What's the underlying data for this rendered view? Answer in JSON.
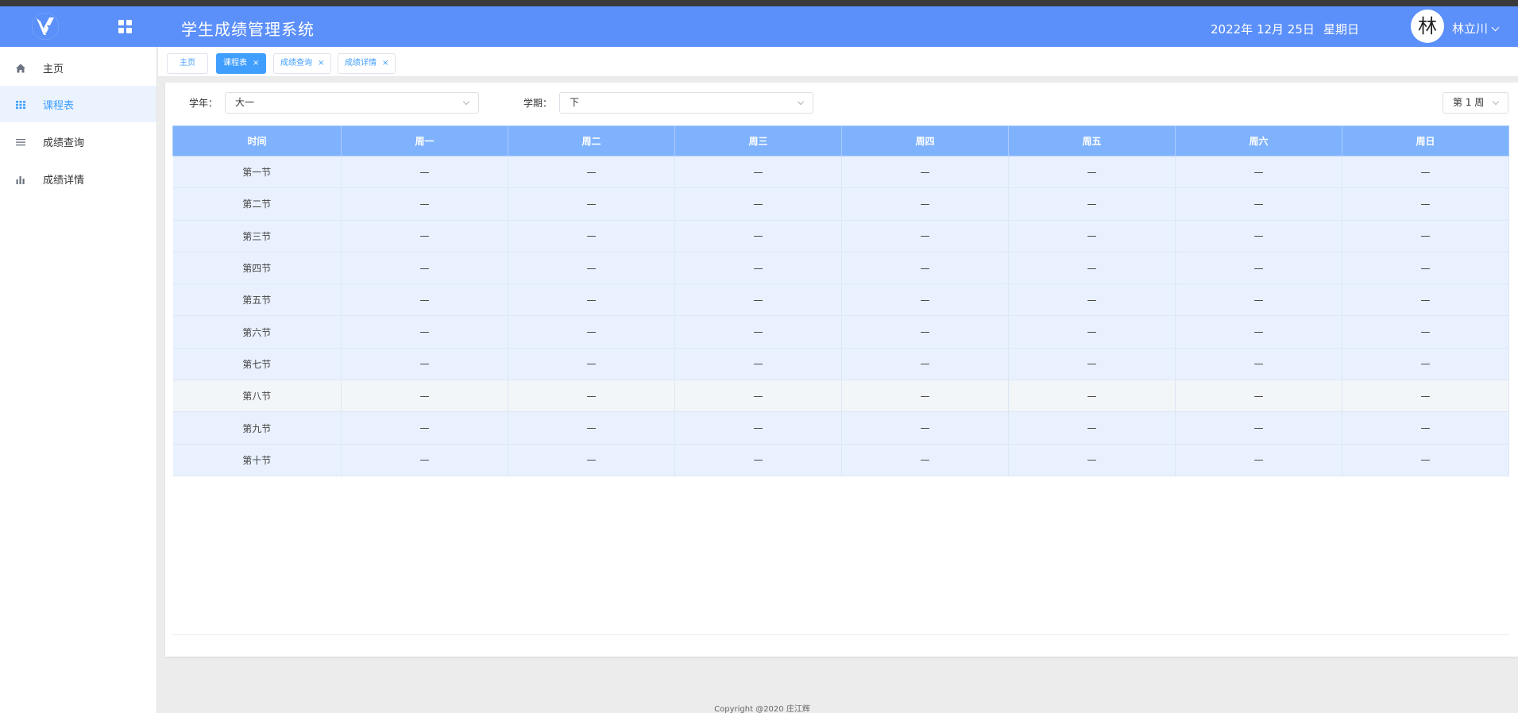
{
  "header": {
    "title": "学生成绩管理系统",
    "date": "2022年 12月 25日",
    "weekday": "星期日",
    "avatar_char": "林",
    "username": "林立川",
    "color": "#5b8ff9"
  },
  "sidebar": {
    "items": [
      {
        "label": "主页",
        "icon": "home-icon"
      },
      {
        "label": "课程表",
        "icon": "grid-icon",
        "active": true
      },
      {
        "label": "成绩查询",
        "icon": "list-icon"
      },
      {
        "label": "成绩详情",
        "icon": "bar-chart-icon"
      }
    ]
  },
  "tabs": [
    {
      "label": "主页",
      "closable": false
    },
    {
      "label": "课程表",
      "closable": true,
      "active": true
    },
    {
      "label": "成绩查询",
      "closable": true
    },
    {
      "label": "成绩详情",
      "closable": true
    }
  ],
  "tab_close_glyph": "×",
  "filters": {
    "year_label": "学年：",
    "year_value": "大一",
    "term_label": "学期：",
    "term_value": "下",
    "week_value": "第 1 周"
  },
  "timetable": {
    "columns": [
      "时间",
      "周一",
      "周二",
      "周三",
      "周四",
      "周五",
      "周六",
      "周日"
    ],
    "rows": [
      "第一节",
      "第二节",
      "第三节",
      "第四节",
      "第五节",
      "第六节",
      "第七节",
      "第八节",
      "第九节",
      "第十节"
    ],
    "empty_cell": "—",
    "header_color": "#7fb2fd",
    "row_color": "#e9f1fe"
  },
  "footer": {
    "copyright": "Copyright @2020 庄江辉"
  }
}
